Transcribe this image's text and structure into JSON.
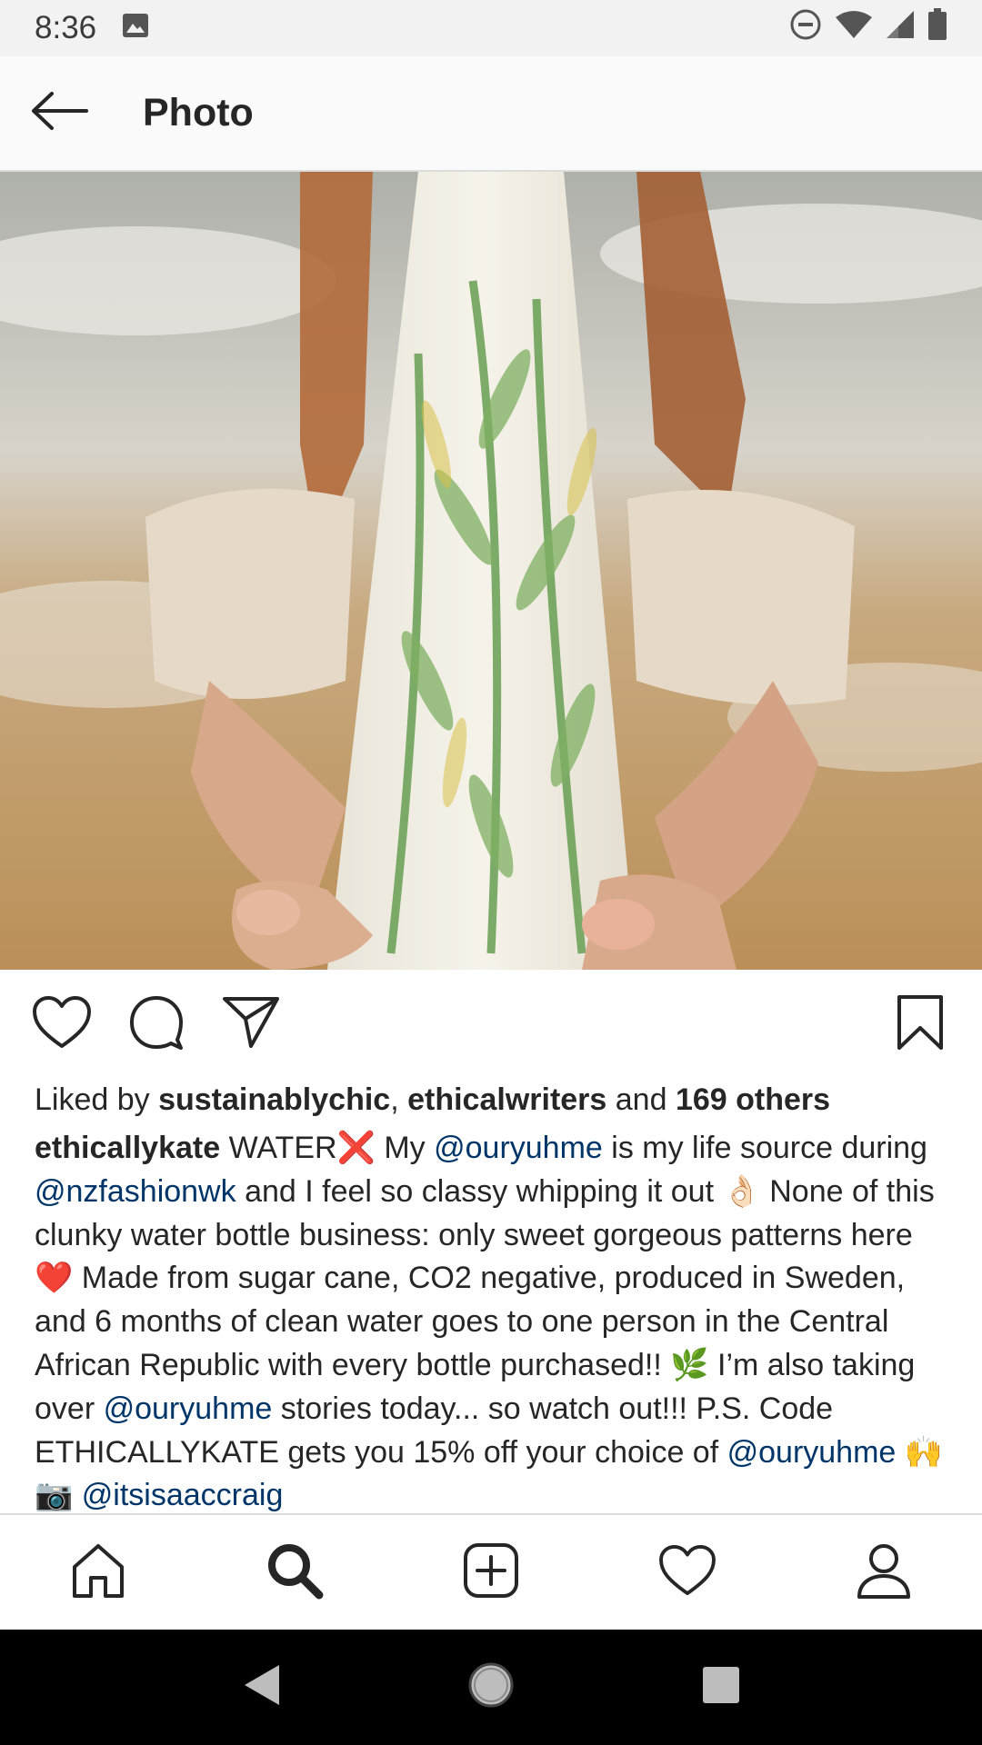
{
  "status_bar": {
    "time": "8:36",
    "icons": [
      "image-notification-icon",
      "do-not-disturb-icon",
      "wifi-icon",
      "signal-icon",
      "battery-icon"
    ]
  },
  "app_bar": {
    "title": "Photo",
    "back_icon": "arrow-left-icon"
  },
  "post": {
    "actions": [
      "heart-icon",
      "comment-icon",
      "share-icon",
      "bookmark-icon"
    ],
    "likes": {
      "prefix": "Liked by ",
      "user1": "sustainablychic",
      "sep": ", ",
      "user2": "ethicalwriters",
      "and": " and ",
      "others": "169 others"
    },
    "caption": {
      "username": "ethicallykate",
      "t1": " WATER❌ My ",
      "m1": "@ouryuhme",
      "t2": " is my life source during ",
      "m2": "@nzfashionwk",
      "t3": " and I feel so classy whipping it out 👌🏻 None of this clunky water bottle business: only sweet gorgeous patterns here ❤️ Made from sugar cane, CO2 negative, produced in Sweden, and 6 months of clean water goes to one person in the Central African Republic with every bottle purchased!! 🌿 I’m also taking over ",
      "m3": "@ouryuhme",
      "t4": " stories today... so watch out!!! P.S. Code ETHICALLYKATE gets you 15% off your choice of ",
      "m4": "@ouryuhme",
      "t5": " 🙌 📷 ",
      "m5": "@itsisaaccraig"
    }
  },
  "bottom_nav": {
    "items": [
      "home-icon",
      "search-icon",
      "add-post-icon",
      "activity-heart-icon",
      "profile-icon"
    ],
    "active": "search-icon"
  },
  "system_nav": [
    "back-triangle-icon",
    "home-circle-icon",
    "recents-square-icon"
  ],
  "colors": {
    "mention": "#003569",
    "text": "#262626",
    "status_bg": "#f2f2f2"
  }
}
